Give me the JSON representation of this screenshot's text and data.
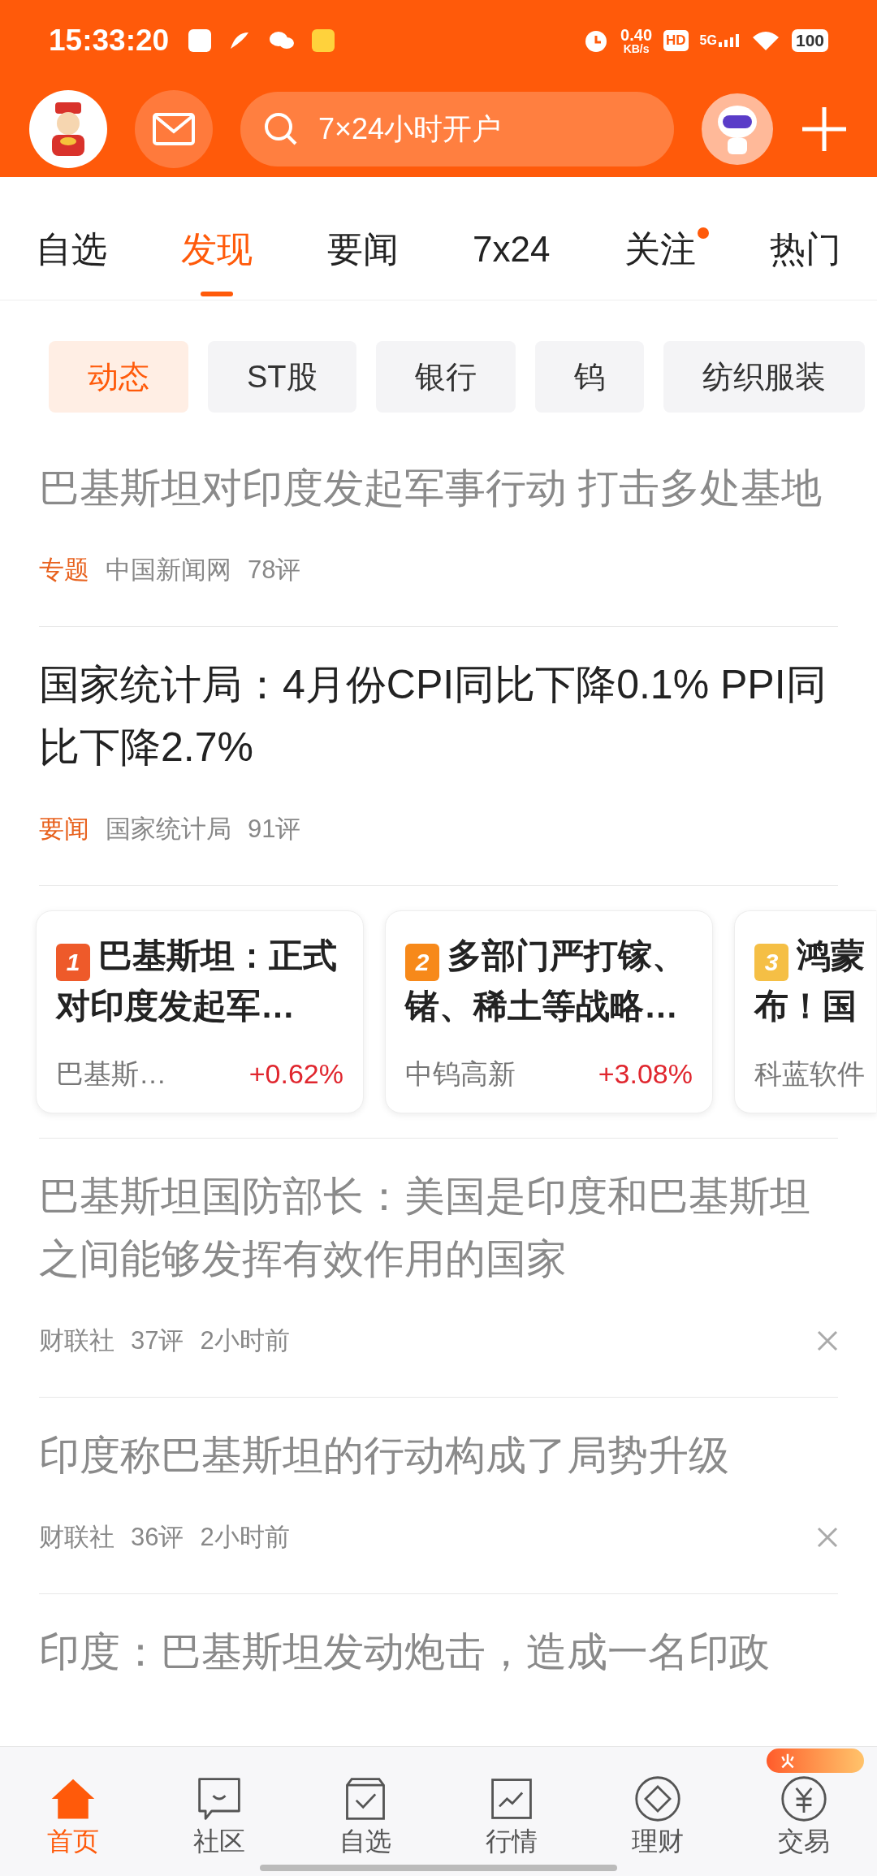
{
  "status_bar": {
    "time": "15:33:20",
    "speed": "0.40",
    "speed_unit": "KB/s",
    "hd": "HD",
    "network": "5G",
    "battery": "100"
  },
  "header": {
    "search": {
      "placeholder": "7×24小时开户"
    }
  },
  "tabs": [
    {
      "label": "自选",
      "selected": false,
      "dot": false
    },
    {
      "label": "发现",
      "selected": true,
      "dot": false
    },
    {
      "label": "要闻",
      "selected": false,
      "dot": false
    },
    {
      "label": "7x24",
      "selected": false,
      "dot": false
    },
    {
      "label": "关注",
      "selected": false,
      "dot": true
    },
    {
      "label": "热门",
      "selected": false,
      "dot": false
    }
  ],
  "chips": [
    {
      "label": "动态",
      "selected": true
    },
    {
      "label": "ST股",
      "selected": false
    },
    {
      "label": "银行",
      "selected": false
    },
    {
      "label": "钨",
      "selected": false
    },
    {
      "label": "纺织服装",
      "selected": false
    }
  ],
  "news_top": [
    {
      "title": "巴基斯坦对印度发起军事行动 打击多处基地",
      "read": true,
      "tag": "专题",
      "source": "中国新闻网",
      "comments": "78评"
    },
    {
      "title": "国家统计局：4月份CPI同比下降0.1% PPI同比下降2.7%",
      "read": false,
      "tag": "要闻",
      "source": "国家统计局",
      "comments": "91评"
    }
  ],
  "hot_cards": [
    {
      "rank": "1",
      "color": "#ee5a2a",
      "title": "巴基斯坦：正式对印度发起军…",
      "stock": "巴基斯…",
      "change": "+0.62%"
    },
    {
      "rank": "2",
      "color": "#f7891a",
      "title": "多部门严打镓、锗、稀土等战略…",
      "stock": "中钨高新",
      "change": "+3.08%"
    },
    {
      "rank": "3",
      "color": "#f5bf45",
      "title": "鸿蒙布！国",
      "stock": "科蓝软件"
    }
  ],
  "news": [
    {
      "title": "巴基斯坦国防部长：美国是印度和巴基斯坦之间能够发挥有效作用的国家",
      "read": true,
      "source": "财联社",
      "comments": "37评",
      "time": "2小时前"
    },
    {
      "title": "印度称巴基斯坦的行动构成了局势升级",
      "read": true,
      "source": "财联社",
      "comments": "36评",
      "time": "2小时前"
    },
    {
      "title": "印度：巴基斯坦发动炮击，造成一名印政",
      "read": true
    }
  ],
  "bottom_nav": [
    {
      "label": "首页",
      "selected": true
    },
    {
      "label": "社区",
      "selected": false
    },
    {
      "label": "自选",
      "selected": false
    },
    {
      "label": "行情",
      "selected": false
    },
    {
      "label": "理财",
      "selected": false
    },
    {
      "label": "交易",
      "selected": false
    }
  ]
}
